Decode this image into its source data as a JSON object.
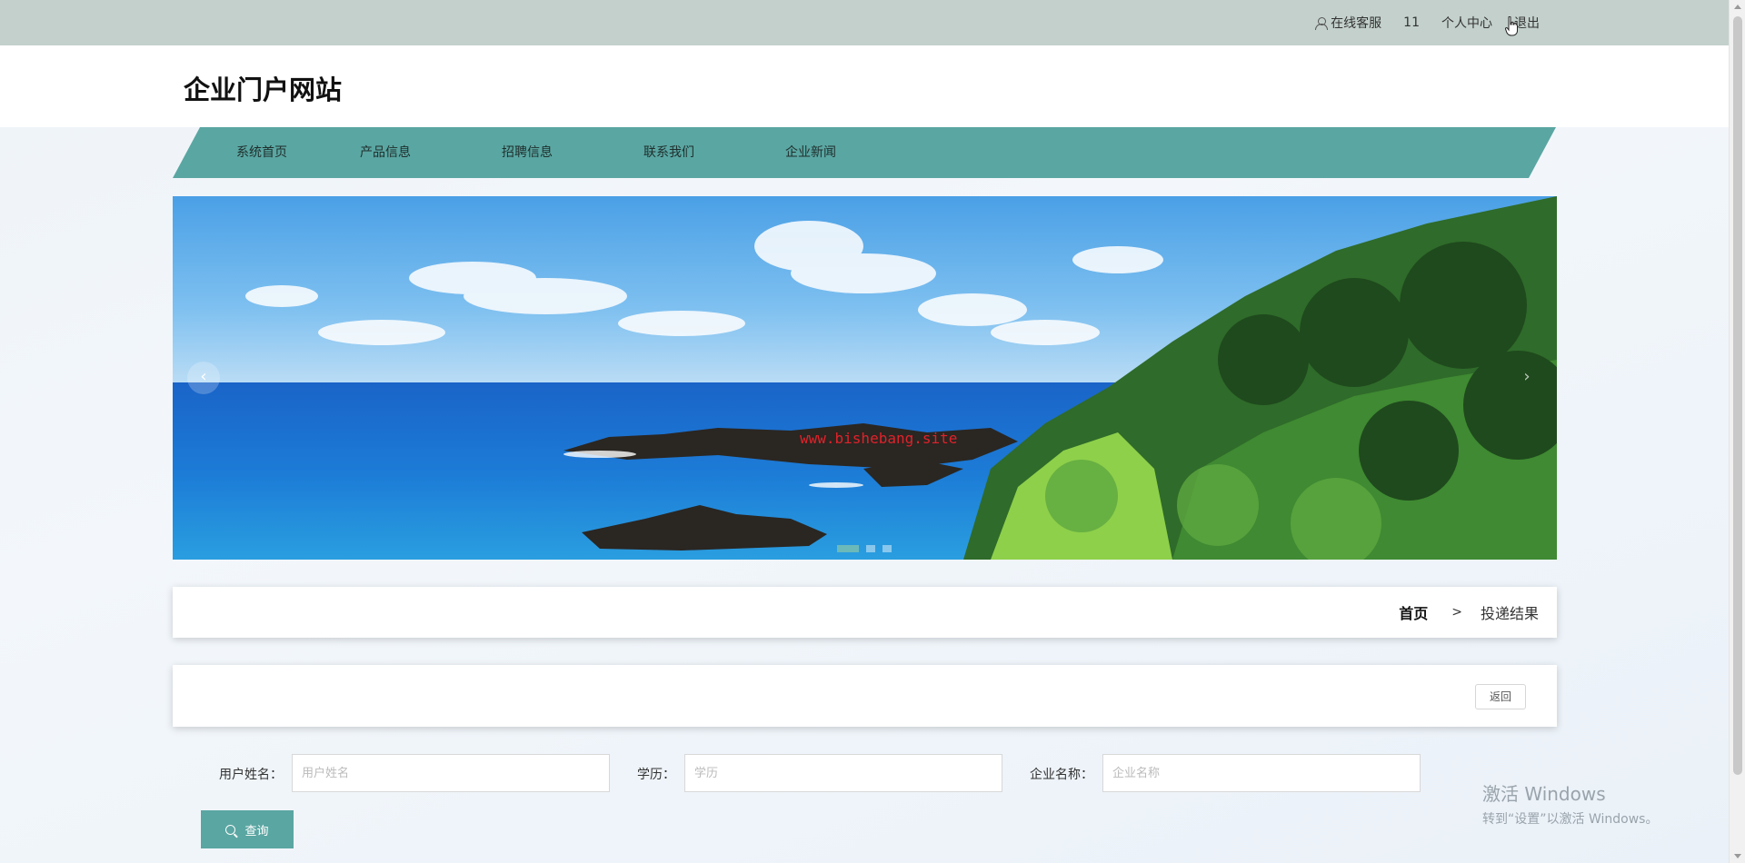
{
  "topbar": {
    "service_label": "在线客服",
    "username": "11",
    "profile_label": "个人中心",
    "logout_label": "退出"
  },
  "header": {
    "site_title": "企业门户网站"
  },
  "nav": {
    "items": [
      {
        "label": "系统首页"
      },
      {
        "label": "产品信息"
      },
      {
        "label": "招聘信息"
      },
      {
        "label": "联系我们"
      },
      {
        "label": "企业新闻"
      }
    ]
  },
  "banner": {
    "watermark": "www.bishebang.site",
    "prev_glyph": "‹",
    "next_glyph": "›",
    "slide_count": 3,
    "active_slide": 1
  },
  "breadcrumb": {
    "home": "首页",
    "separator": ">",
    "current": "投递结果"
  },
  "actions": {
    "back_label": "返回"
  },
  "search": {
    "username_label": "用户姓名：",
    "username_placeholder": "用户姓名",
    "username_value": "",
    "education_label": "学历：",
    "education_placeholder": "学历",
    "education_value": "",
    "company_label": "企业名称：",
    "company_placeholder": "企业名称",
    "company_value": "",
    "query_label": "查询"
  },
  "os_watermark": {
    "line1": "激活 Windows",
    "line2": "转到“设置”以激活 Windows。"
  },
  "colors": {
    "accent": "#5aa6a2",
    "topbar": "#c3d0cb",
    "watermark_red": "#e0222a"
  }
}
